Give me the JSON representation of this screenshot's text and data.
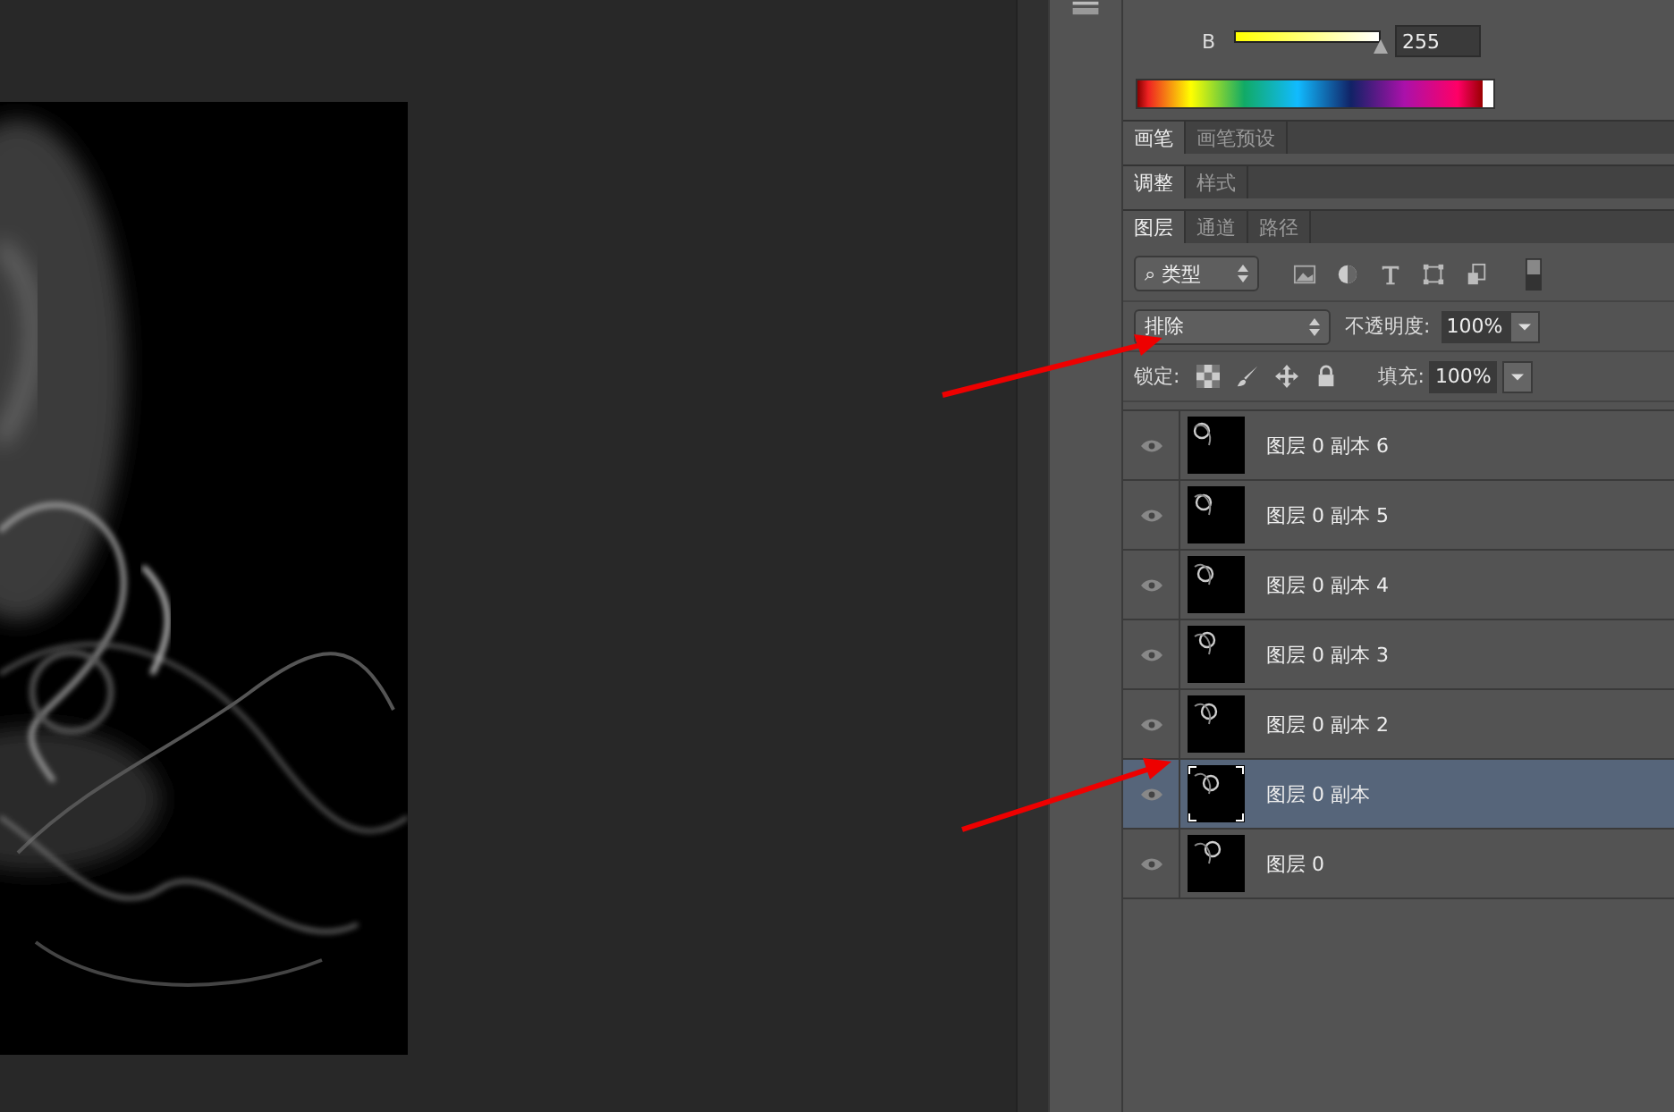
{
  "color_panel": {
    "channel": {
      "label": "B",
      "level": 1,
      "value": "255"
    }
  },
  "panel_groups": [
    {
      "tabs": [
        {
          "label": "画笔",
          "selected": true
        },
        {
          "label": "画笔预设",
          "selected": false
        }
      ]
    },
    {
      "tabs": [
        {
          "label": "调整",
          "selected": true
        },
        {
          "label": "样式",
          "selected": false
        }
      ]
    },
    {
      "tabs": [
        {
          "label": "图层",
          "selected": true
        },
        {
          "label": "通道",
          "selected": false
        },
        {
          "label": "路径",
          "selected": false
        }
      ]
    }
  ],
  "layers_panel": {
    "filter": {
      "icon": "⌕",
      "value": "类型"
    },
    "blend_mode": "排除",
    "opacity_label": "不透明度:",
    "opacity": "100%",
    "lock_label": "锁定:",
    "fill_label": "填充:",
    "fill": "100%",
    "layers": [
      {
        "name": "图层 0 副本 6",
        "visible": true,
        "selected": false
      },
      {
        "name": "图层 0 副本 5",
        "visible": true,
        "selected": false
      },
      {
        "name": "图层 0 副本 4",
        "visible": true,
        "selected": false
      },
      {
        "name": "图层 0 副本 3",
        "visible": true,
        "selected": false
      },
      {
        "name": "图层 0 副本 2",
        "visible": true,
        "selected": false
      },
      {
        "name": "图层 0 副本",
        "visible": true,
        "selected": true
      },
      {
        "name": "图层 0",
        "visible": true,
        "selected": false
      }
    ]
  },
  "annotations": [
    {
      "kind": "arrow"
    },
    {
      "kind": "arrow"
    }
  ]
}
